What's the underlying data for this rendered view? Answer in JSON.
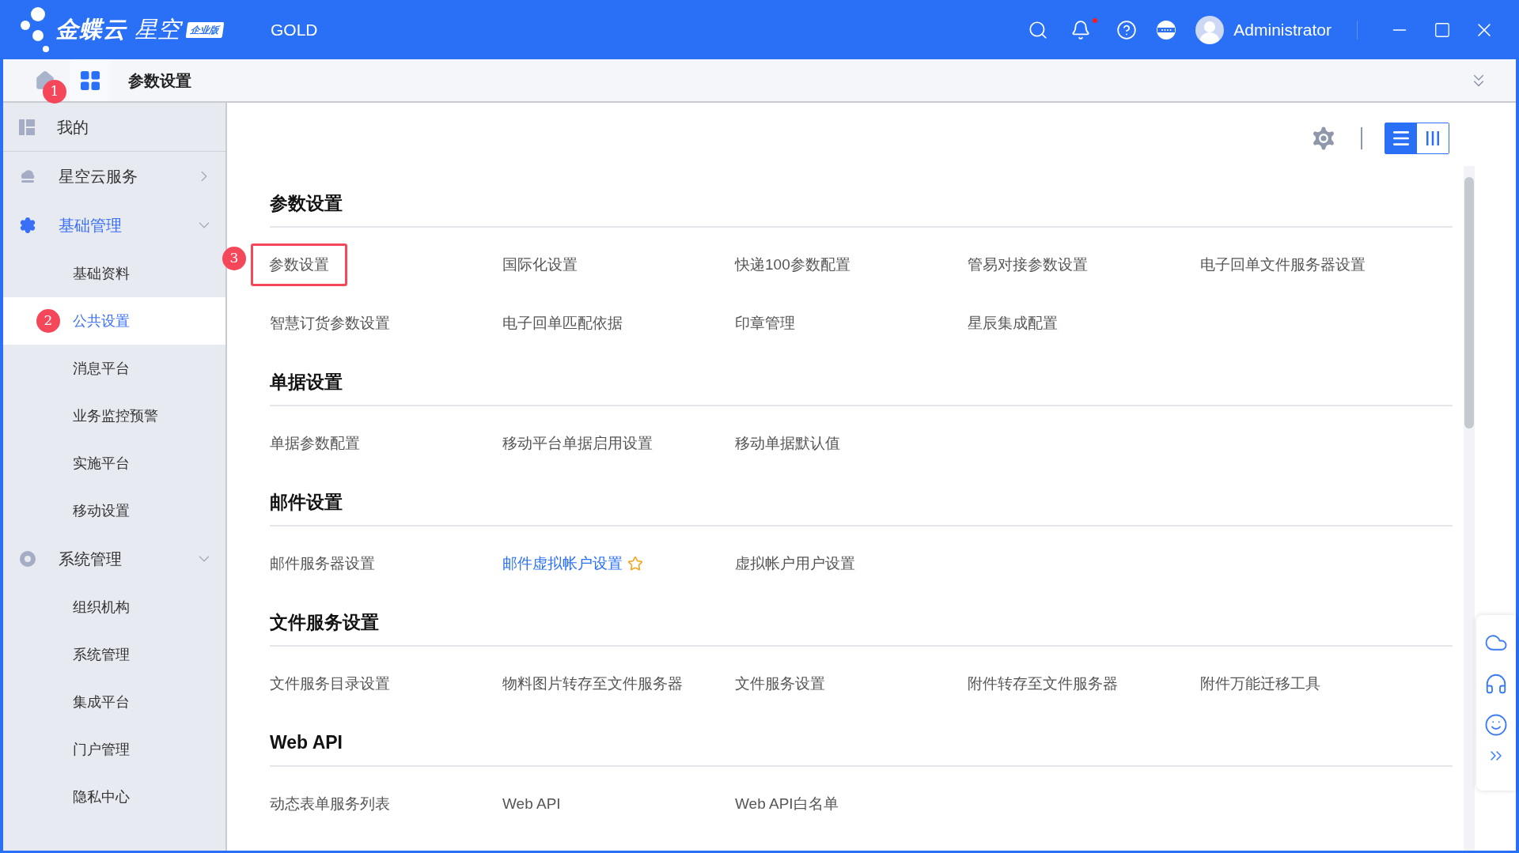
{
  "app": {
    "brand": "金蝶云",
    "product": "星空",
    "edition": "企业版",
    "tenant": "GOLD",
    "user": "Administrator",
    "has_notification": true
  },
  "tabbar": {
    "home_badge": "1",
    "tabs": [
      {
        "label": "参数设置",
        "selected": true
      }
    ]
  },
  "sidebar": {
    "items": [
      {
        "kind": "link",
        "label": "我的",
        "active": false
      },
      {
        "kind": "group",
        "label": "星空云服务",
        "active": false,
        "expanded": false
      },
      {
        "kind": "group",
        "label": "基础管理",
        "active": true,
        "expanded": true,
        "children": [
          {
            "label": "基础资料",
            "selected": false
          },
          {
            "label": "公共设置",
            "selected": true,
            "badge": "2"
          },
          {
            "label": "消息平台",
            "selected": false
          },
          {
            "label": "业务监控预警",
            "selected": false
          },
          {
            "label": "实施平台",
            "selected": false
          },
          {
            "label": "移动设置",
            "selected": false
          }
        ]
      },
      {
        "kind": "group",
        "label": "系统管理",
        "active": false,
        "expanded": true,
        "children": [
          {
            "label": "组织机构",
            "selected": false
          },
          {
            "label": "系统管理",
            "selected": false
          },
          {
            "label": "集成平台",
            "selected": false
          },
          {
            "label": "门户管理",
            "selected": false
          },
          {
            "label": "隐私中心",
            "selected": false
          }
        ]
      }
    ]
  },
  "view_buttons": [
    {
      "kind": "list",
      "selected": true
    },
    {
      "kind": "columns",
      "selected": false
    }
  ],
  "sections": [
    {
      "title": "参数设置",
      "items": [
        {
          "label": "参数设置",
          "favorite": false,
          "marked": true,
          "badge": "3"
        },
        {
          "label": "国际化设置",
          "favorite": false,
          "marked": false
        },
        {
          "label": "快递100参数配置",
          "favorite": false,
          "marked": false
        },
        {
          "label": "管易对接参数设置",
          "favorite": false,
          "marked": false
        },
        {
          "label": "电子回单文件服务器设置",
          "favorite": false,
          "marked": false
        },
        {
          "label": "智慧订货参数设置",
          "favorite": false,
          "marked": false
        },
        {
          "label": "电子回单匹配依据",
          "favorite": false,
          "marked": false
        },
        {
          "label": "印章管理",
          "favorite": false,
          "marked": false
        },
        {
          "label": "星辰集成配置",
          "favorite": false,
          "marked": false
        }
      ]
    },
    {
      "title": "单据设置",
      "items": [
        {
          "label": "单据参数配置",
          "favorite": false,
          "marked": false
        },
        {
          "label": "移动平台单据启用设置",
          "favorite": false,
          "marked": false
        },
        {
          "label": "移动单据默认值",
          "favorite": false,
          "marked": false
        }
      ]
    },
    {
      "title": "邮件设置",
      "items": [
        {
          "label": "邮件服务器设置",
          "favorite": false,
          "marked": false
        },
        {
          "label": "邮件虚拟帐户设置",
          "favorite": true,
          "marked": false
        },
        {
          "label": "虚拟帐户用户设置",
          "favorite": false,
          "marked": false
        }
      ]
    },
    {
      "title": "文件服务设置",
      "items": [
        {
          "label": "文件服务目录设置",
          "favorite": false,
          "marked": false
        },
        {
          "label": "物料图片转存至文件服务器",
          "favorite": false,
          "marked": false
        },
        {
          "label": "文件服务设置",
          "favorite": false,
          "marked": false
        },
        {
          "label": "附件转存至文件服务器",
          "favorite": false,
          "marked": false
        },
        {
          "label": "附件万能迁移工具",
          "favorite": false,
          "marked": false
        }
      ]
    },
    {
      "title": "Web API",
      "items": [
        {
          "label": "动态表单服务列表",
          "favorite": false,
          "marked": false
        },
        {
          "label": "Web API",
          "favorite": false,
          "marked": false
        },
        {
          "label": "Web API白名单",
          "favorite": false,
          "marked": false
        }
      ]
    }
  ]
}
